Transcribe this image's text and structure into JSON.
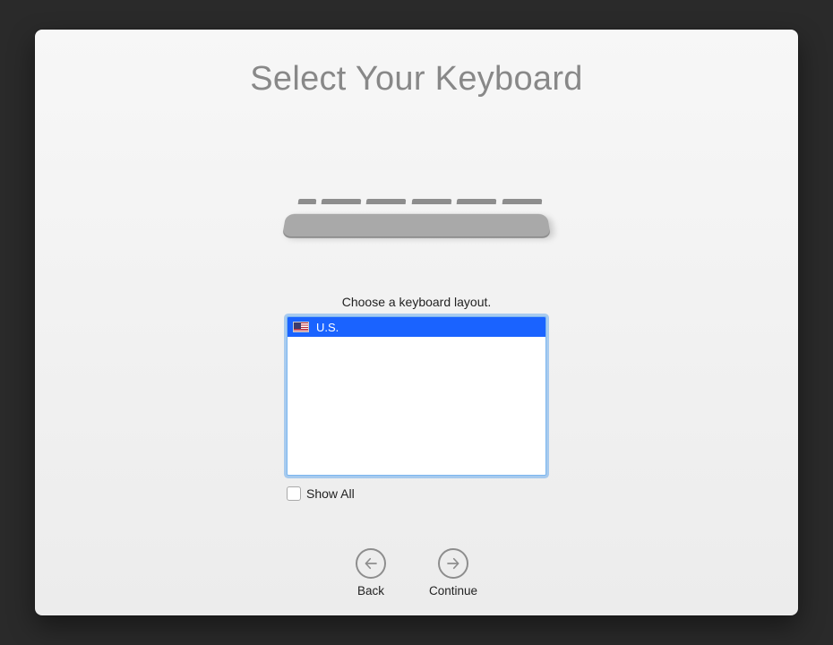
{
  "title": "Select Your Keyboard",
  "prompt": "Choose a keyboard layout.",
  "layouts": {
    "items": [
      {
        "label": "U.S.",
        "flag": "us",
        "selected": true
      }
    ]
  },
  "show_all": {
    "label": "Show All",
    "checked": false
  },
  "nav": {
    "back_label": "Back",
    "continue_label": "Continue"
  }
}
